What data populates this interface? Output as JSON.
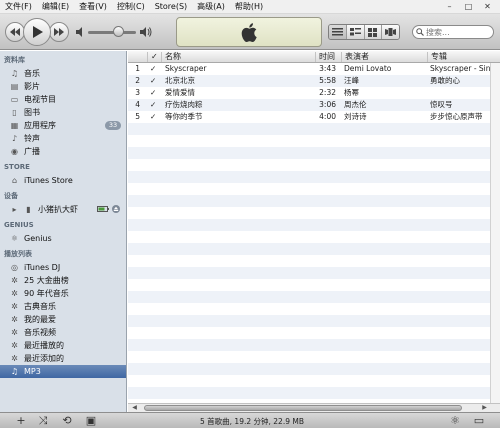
{
  "menu": [
    "文件(F)",
    "编辑(E)",
    "查看(V)",
    "控制(C)",
    "Store(S)",
    "高级(A)",
    "帮助(H)"
  ],
  "window_controls": [
    "–",
    "□",
    "✕"
  ],
  "search": {
    "placeholder": "搜索..."
  },
  "sidebar": {
    "library": {
      "header": "资料库",
      "items": [
        {
          "label": "音乐",
          "icon": "music-note-icon"
        },
        {
          "label": "影片",
          "icon": "film-icon"
        },
        {
          "label": "电视节目",
          "icon": "tv-icon"
        },
        {
          "label": "图书",
          "icon": "book-icon"
        },
        {
          "label": "应用程序",
          "icon": "apps-icon",
          "badge": "33"
        },
        {
          "label": "铃声",
          "icon": "bell-icon"
        },
        {
          "label": "广播",
          "icon": "radio-icon"
        }
      ]
    },
    "store": {
      "header": "STORE",
      "items": [
        {
          "label": "iTunes Store",
          "icon": "store-icon"
        }
      ]
    },
    "devices": {
      "header": "设备",
      "items": [
        {
          "label": "小猪扒大虾",
          "icon": "device-icon"
        }
      ]
    },
    "genius": {
      "header": "GENIUS",
      "items": [
        {
          "label": "Genius",
          "icon": "genius-icon"
        }
      ]
    },
    "playlists": {
      "header": "播放列表",
      "items": [
        {
          "label": "iTunes DJ",
          "icon": "dj-icon"
        },
        {
          "label": "25 大金曲榜",
          "icon": "smart-playlist-icon"
        },
        {
          "label": "90 年代音乐",
          "icon": "smart-playlist-icon"
        },
        {
          "label": "古典音乐",
          "icon": "smart-playlist-icon"
        },
        {
          "label": "我的最爱",
          "icon": "smart-playlist-icon"
        },
        {
          "label": "音乐视频",
          "icon": "smart-playlist-icon"
        },
        {
          "label": "最近播放的",
          "icon": "smart-playlist-icon"
        },
        {
          "label": "最近添加的",
          "icon": "smart-playlist-icon"
        },
        {
          "label": "MP3",
          "icon": "playlist-icon",
          "selected": true
        }
      ]
    }
  },
  "columns": {
    "check": "✓",
    "name": "名称",
    "time": "时间",
    "artist": "表演者",
    "album": "专辑"
  },
  "songs": [
    {
      "num": "1",
      "name": "Skyscraper",
      "time": "3:43",
      "artist": "Demi Lovato",
      "album": "Skyscraper - Sing"
    },
    {
      "num": "2",
      "name": "北京北京",
      "time": "5:58",
      "artist": "汪峰",
      "album": "勇敢的心"
    },
    {
      "num": "3",
      "name": "爱情爱情",
      "time": "2:32",
      "artist": "杨幂",
      "album": ""
    },
    {
      "num": "4",
      "name": "疗伤烧肉粽",
      "time": "3:06",
      "artist": "周杰伦",
      "album": "惊叹号"
    },
    {
      "num": "5",
      "name": "等你的季节",
      "time": "4:00",
      "artist": "刘诗诗",
      "album": "步步惊心原声带"
    }
  ],
  "status": "5 首歌曲, 19.2 分钟, 22.9 MB",
  "colors": {
    "sidebar_bg": "#d9e0e8",
    "selection": "#3f67a3",
    "row_alt": "#eef2f8"
  }
}
